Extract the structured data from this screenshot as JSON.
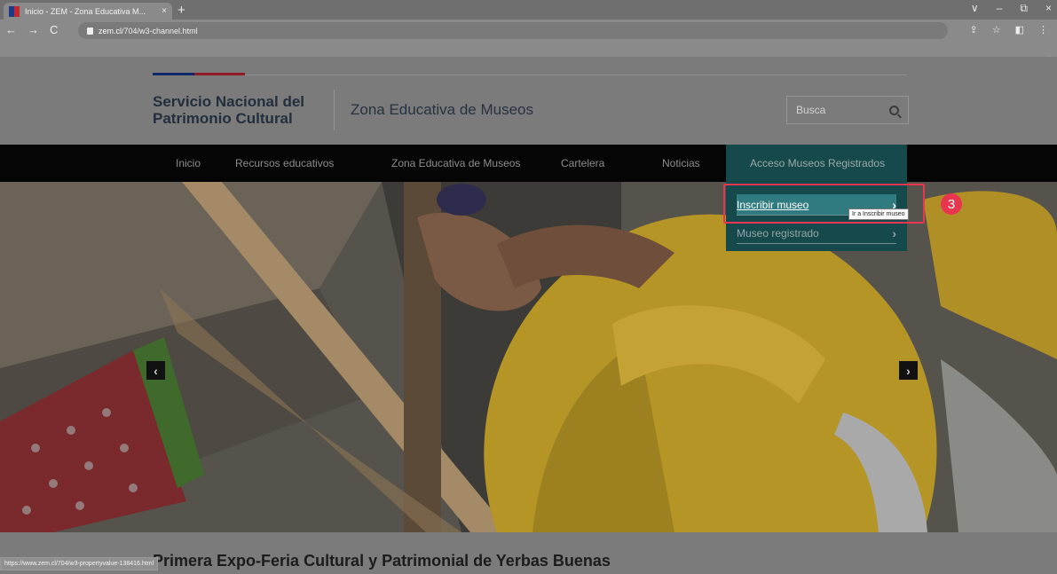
{
  "browser": {
    "tab_title": "Inicio - ZEM - Zona Educativa M...",
    "tab_close": "×",
    "new_tab": "+",
    "url_host": "zem.cl",
    "url_path": "/704/w3-channel.html",
    "window_controls": [
      "∨",
      "–",
      "⧉",
      "×"
    ],
    "overflow_chevron": "»",
    "status_url": "https://www.zem.cl/704/w3-propertyvalue-138416.html"
  },
  "header": {
    "org_name": "Servicio Nacional del Patrimonio Cultural",
    "site_title": "Zona Educativa de Museos",
    "search_placeholder": "Busca"
  },
  "nav": {
    "items": [
      {
        "label": "Inicio"
      },
      {
        "label": "Recursos educativos"
      },
      {
        "label": "Zona Educativa de Museos"
      },
      {
        "label": "Cartelera"
      },
      {
        "label": "Noticias"
      },
      {
        "label": "Acceso Museos Registrados"
      }
    ]
  },
  "dropdown": {
    "items": [
      {
        "label": "Inscribir museo",
        "chevron": "›"
      },
      {
        "label": "Museo registrado",
        "chevron": "›"
      }
    ],
    "tooltip": "Ir a Inscribir museo"
  },
  "annotation": {
    "step": "3",
    "color": "#e8364e"
  },
  "carousel": {
    "prev": "‹",
    "next": "›"
  },
  "news": {
    "title": "Primera Expo-Feria Cultural y Patrimonial de Yerbas Buenas"
  },
  "colors": {
    "nav_active": "#15494c",
    "dropdown_focus": "#2f7b80",
    "hero_yellow": "#b59526"
  }
}
